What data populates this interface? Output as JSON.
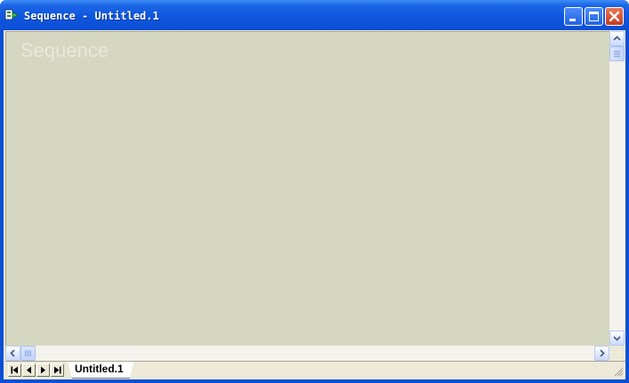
{
  "window": {
    "title": "Sequence - Untitled.1",
    "icon": "sequence-app-icon",
    "controls": [
      "minimize-icon",
      "maximize-icon",
      "close-icon"
    ]
  },
  "canvas": {
    "watermark": "Sequence",
    "background_color": "#d5d7c1"
  },
  "scrollbars": {
    "vertical": {
      "up_icon": "chevron-up-icon",
      "down_icon": "chevron-down-icon"
    },
    "horizontal": {
      "left_icon": "chevron-left-icon",
      "right_icon": "chevron-right-icon"
    }
  },
  "sheet_nav": {
    "buttons": [
      "first-sheet-icon",
      "prev-sheet-icon",
      "next-sheet-icon",
      "last-sheet-icon"
    ],
    "tabs": [
      {
        "label": "Untitled.1",
        "active": true
      }
    ]
  },
  "colors": {
    "titlebar": "#0b4fd6",
    "close_button": "#c6391b",
    "chrome": "#ece9d8"
  }
}
